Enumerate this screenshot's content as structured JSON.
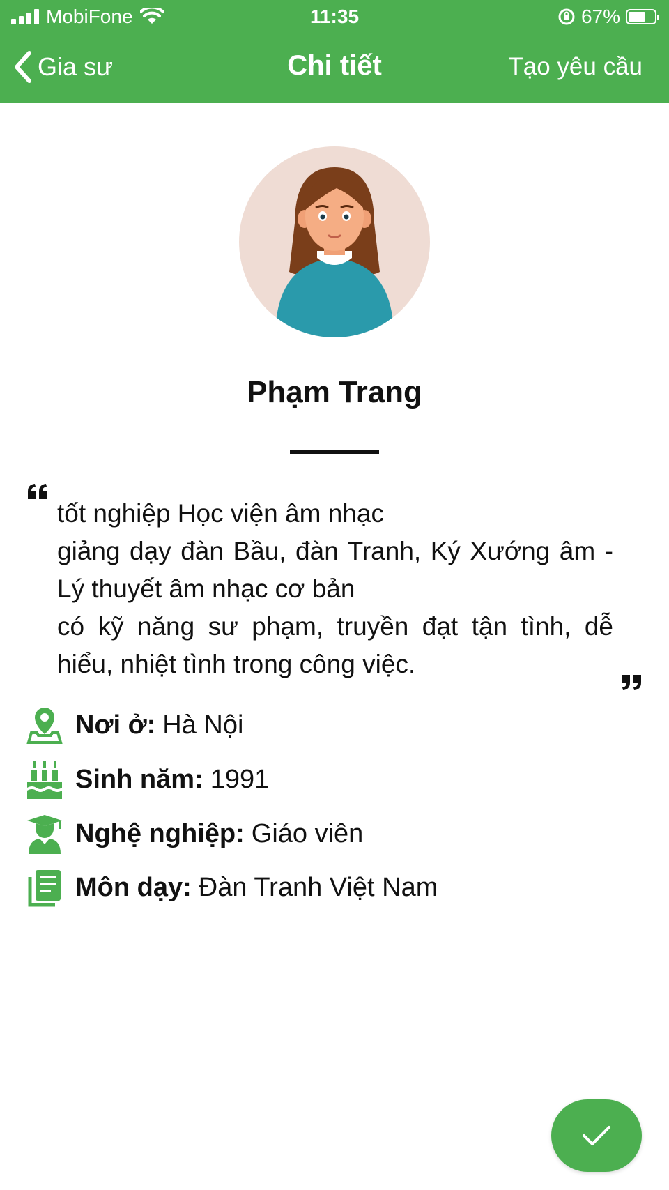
{
  "status_bar": {
    "carrier": "MobiFone",
    "time": "11:35",
    "battery": "67%",
    "battery_level": 0.67
  },
  "nav": {
    "back_label": "Gia sư",
    "title": "Chi tiết",
    "action_label": "Tạo yêu cầu"
  },
  "profile": {
    "name": "Phạm Trang",
    "bio_lines": [
      "tốt nghiệp Học viện âm nhạc",
      "giảng dạy đàn Bầu, đàn Tranh, Ký Xướng âm - Lý thuyết âm nhạc cơ bản",
      "có kỹ năng sư phạm, truyền đạt tận tình, dễ hiểu, nhiệt tình trong công việc."
    ],
    "details": [
      {
        "icon": "location-pin-icon",
        "label": "Nơi ở:",
        "value": "Hà Nội"
      },
      {
        "icon": "birthday-cake-icon",
        "label": "Sinh năm:",
        "value": "1991"
      },
      {
        "icon": "graduate-icon",
        "label": "Nghệ nghiệp:",
        "value": "Giáo viên"
      },
      {
        "icon": "subject-book-icon",
        "label": "Môn dạy:",
        "value": "Đàn Tranh Việt Nam"
      }
    ]
  },
  "colors": {
    "accent": "#4caf50",
    "avatar_bg": "#efdcd4",
    "text": "#111111"
  }
}
